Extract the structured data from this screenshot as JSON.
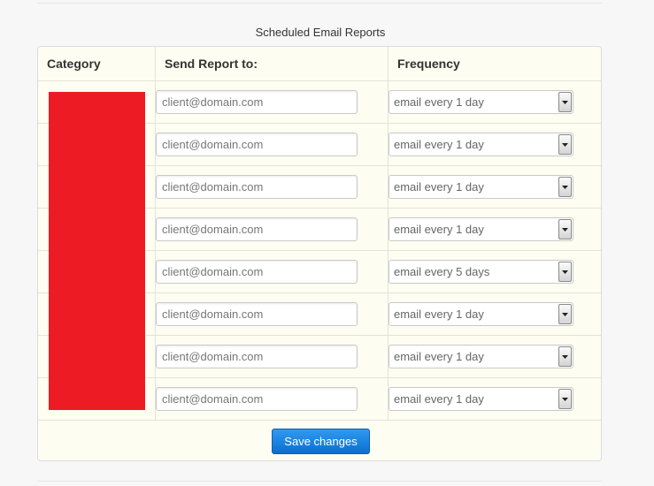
{
  "page": {
    "title": "Scheduled Email Reports"
  },
  "table": {
    "headers": {
      "category": "Category",
      "send_to": "Send Report to:",
      "frequency": "Frequency"
    },
    "rows": [
      {
        "email_placeholder": "client@domain.com",
        "frequency": "email every 1 day"
      },
      {
        "email_placeholder": "client@domain.com",
        "frequency": "email every 1 day"
      },
      {
        "email_placeholder": "client@domain.com",
        "frequency": "email every 1 day"
      },
      {
        "email_placeholder": "client@domain.com",
        "frequency": "email every 1 day"
      },
      {
        "email_placeholder": "client@domain.com",
        "frequency": "email every 5 days"
      },
      {
        "email_placeholder": "client@domain.com",
        "frequency": "email every 1 day"
      },
      {
        "email_placeholder": "client@domain.com",
        "frequency": "email every 1 day"
      },
      {
        "email_placeholder": "client@domain.com",
        "frequency": "email every 1 day"
      }
    ]
  },
  "actions": {
    "save_label": "Save changes"
  },
  "colors": {
    "redaction": "#ed1c24",
    "panel_bg": "#fdfdf1",
    "button_top": "#2f9af0",
    "button_bottom": "#0a6fd1"
  },
  "icons": {
    "select_arrow": "chevron-down-icon"
  }
}
